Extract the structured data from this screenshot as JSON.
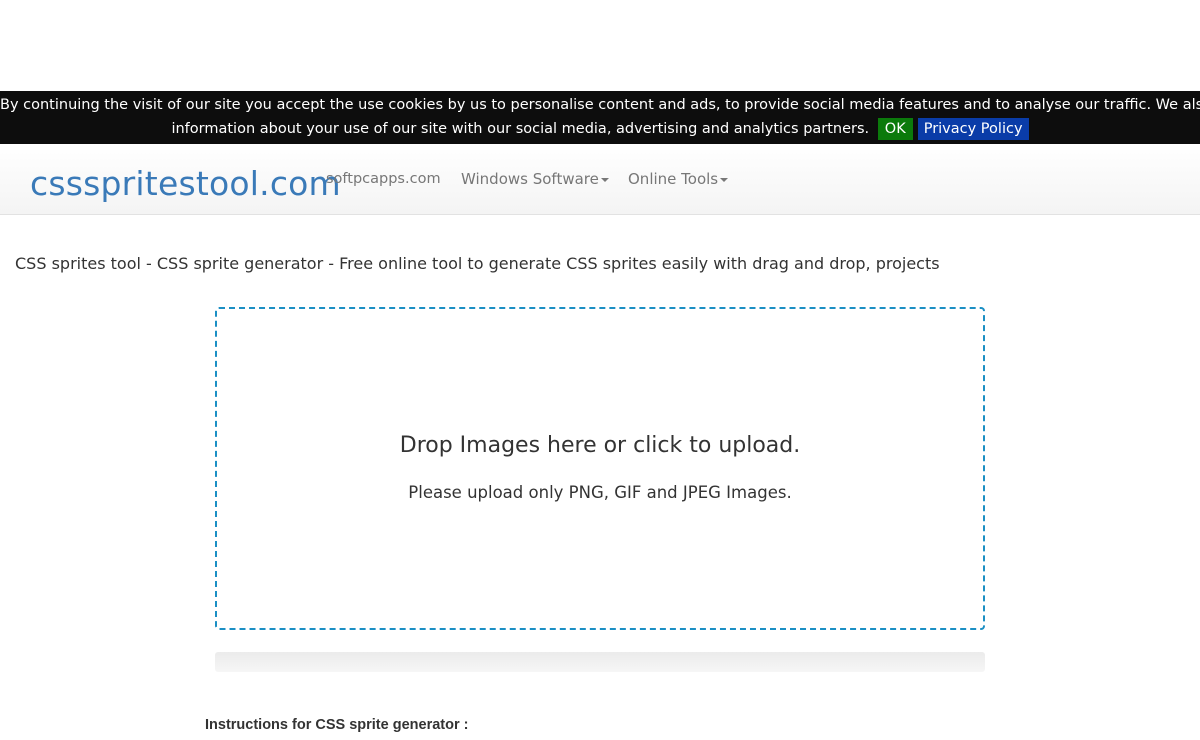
{
  "cookie_bar": {
    "line1": "By continuing the visit of our site you accept the use cookies by us to personalise content and ads, to provide social media features and to analyse our traffic. We also share",
    "line2": "information about your use of our site with our social media, advertising and analytics partners.",
    "ok_label": "OK",
    "privacy_label": "Privacy Policy"
  },
  "navbar": {
    "brand": "cssspritestool.com",
    "links": [
      {
        "label": "softpcapps.com"
      },
      {
        "label": "Windows Software",
        "dropdown": true
      },
      {
        "label": "Online Tools",
        "dropdown": true
      }
    ]
  },
  "main": {
    "description": "CSS sprites tool - CSS sprite generator - Free online tool to generate CSS sprites easily with drag and drop, projects",
    "dropzone": {
      "title": "Drop Images here or click to upload.",
      "note": "Please upload only PNG, GIF and JPEG Images."
    },
    "upload_progress": 0,
    "instructions_heading": "Instructions for CSS sprite generator :"
  },
  "colors": {
    "cookie_bg": "#0d0d0d",
    "ok_bg": "#0b7a0b",
    "privacy_bg": "#0a3ca8",
    "brand": "#3a7ab8",
    "dropzone_border": "#1b8fc4"
  }
}
